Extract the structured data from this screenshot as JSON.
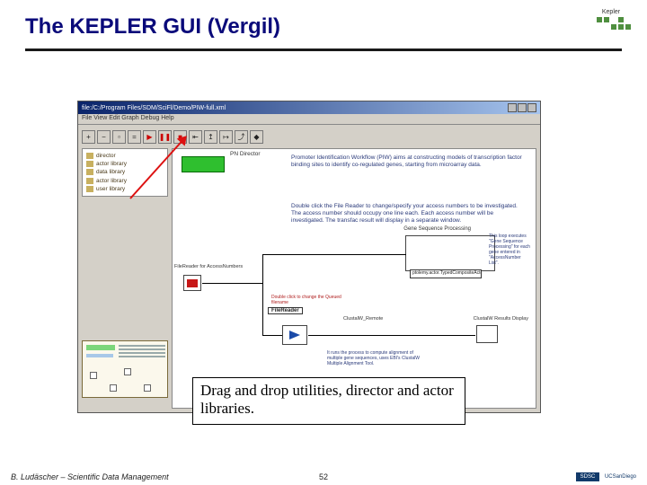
{
  "title": "The KEPLER GUI (Vergil)",
  "header_logo_label": "Kepler",
  "window": {
    "title": "file:/C:/Program Files/SDM/SciFl/Demo/PIW-full.xml",
    "menu": "File  View  Edit  Graph  Debug  Help",
    "toolbar_icons": [
      "zoom-in",
      "zoom-out",
      "zoom-fit",
      "zoom-reset",
      "play",
      "pause",
      "stop",
      "step-back",
      "step",
      "step-over",
      "step-out",
      "cycle"
    ]
  },
  "sidebar": {
    "items": [
      "director",
      "actor library",
      "data library",
      "actor library",
      "user library"
    ]
  },
  "canvas": {
    "pn_director_label": "PN Director",
    "desc1": "Promoter Identification Workflow (PIW) aims at constructing models of transcription factor binding sites to identify co-regulated genes, starting from microarray data.",
    "desc2": "Double click the File Reader to change/specify your access numbers to be investigated. The access number should occupy one line each. Each access number will be investigated.\n\nThe transfac result will display in a separate window.",
    "fr_label": "FileReader for AccessNumbers",
    "gsp_label": "Gene Sequence Processing",
    "gsp_note": "This loop executes \"Gene Sequence Processing\" for each gene entered in \"AccessNumber List\".",
    "stamp": "ptolemy.actor.TypedCompositeActor",
    "fr_red_note": "Double click to change the Queued filename",
    "fr_caption": "FileReader",
    "clustalw_label": "ClustalW_Remote",
    "cwr_label": "ClustalW Results Display",
    "cw_note": "It runs the process to compute alignment of multiple gene sequences, uses EBI's ClustalW Multiple Alignment Tool."
  },
  "callout": "Drag and drop utilities, director and actor libraries.",
  "footer": {
    "author": "B. Ludäscher – Scientific Data Management",
    "page_number": "52",
    "logo1": "SDSC",
    "logo2": "UCSanDiego"
  }
}
